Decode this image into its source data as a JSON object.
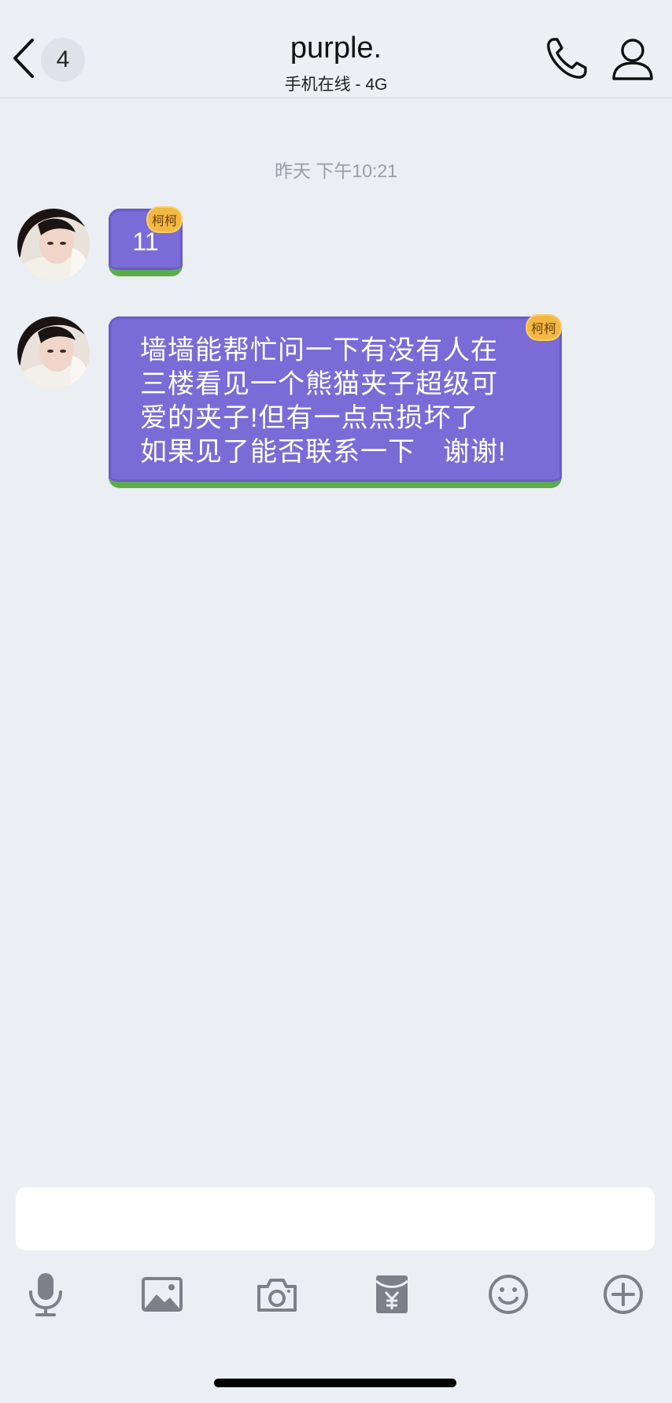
{
  "header": {
    "unread_count": "4",
    "title": "purple.",
    "subtitle": "手机在线 - 4G",
    "icons": {
      "back": "chevron-left-icon",
      "call": "phone-icon",
      "profile": "person-icon"
    }
  },
  "messages": {
    "timestamp": "昨天 下午10:21",
    "items": [
      {
        "text": "11",
        "tag": "柯柯"
      },
      {
        "line1": "墙墙能帮忙问一下有没有人在",
        "line2": "三楼看见一个熊猫夹子超级可",
        "line3": "爱的夹子!但有一点点损坏了",
        "line4": "如果见了能否联系一下　谢谢!",
        "tag": "柯柯"
      }
    ]
  },
  "composer": {
    "input_value": "",
    "tools": [
      "microphone-icon",
      "image-icon",
      "camera-icon",
      "red-packet-icon",
      "emoji-icon",
      "plus-circle-icon"
    ]
  },
  "colors": {
    "bubble": "#7a6bd6",
    "bubble_border": "#5cab4c",
    "tag": "#f3b842",
    "background": "#ebeef3",
    "icon_gray": "#7d8088"
  }
}
